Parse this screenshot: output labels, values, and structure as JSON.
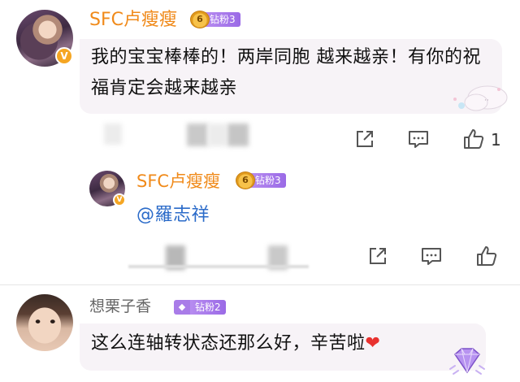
{
  "comments": [
    {
      "username": "SFC卢瘦瘦",
      "verified_mark": "V",
      "fan_badge": {
        "level_icon": "6",
        "label": "钻粉3"
      },
      "text": "我的宝宝棒棒的！两岸同胞  越来越亲！有你的祝福肯定会越来越亲",
      "actions": {
        "like_count": "1"
      }
    },
    {
      "username": "SFC卢瘦瘦",
      "verified_mark": "V",
      "fan_badge": {
        "level_icon": "6",
        "label": "钻粉3"
      },
      "text": "@羅志祥"
    },
    {
      "username": "想栗子香",
      "fan_badge": {
        "level_icon": "◆",
        "label": "钻粉2"
      },
      "text": "这么连轴转状态还那么好，辛苦啦",
      "emoji": "❤"
    }
  ],
  "icons": [
    "share-icon",
    "comment-icon",
    "like-icon",
    "diamond-fan-icon",
    "crown-icon",
    "cloud-decoration",
    "gem-decoration"
  ],
  "colors": {
    "username": "#f08a1a",
    "mention": "#2b6bc9",
    "badge": "#a97ce8",
    "verified": "#f5a623",
    "heart": "#e8312f"
  }
}
